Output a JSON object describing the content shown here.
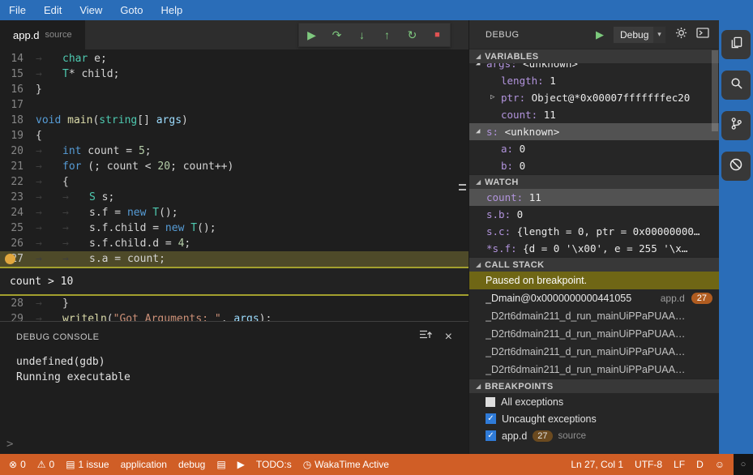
{
  "menubar": {
    "items": [
      "File",
      "Edit",
      "View",
      "Goto",
      "Help"
    ]
  },
  "tab": {
    "name": "app.d",
    "hint": "source"
  },
  "icons": {
    "section": "◢",
    "expanded": "◢",
    "collapsed": "▷",
    "play": "▶",
    "step_over": "↷",
    "step_into": "↓",
    "step_out": "↑",
    "restart": "↻",
    "stop": "■",
    "close": "×",
    "dropdown_caret": "▾",
    "check": "✓",
    "error": "⊗",
    "warning": "⚠",
    "issues": "▤",
    "note": "▤",
    "run_arrow": "▶",
    "clock": "◷",
    "smiley": "☺",
    "circle": "○",
    "prompt": ">"
  },
  "debug_toolbar": {
    "buttons": [
      {
        "name": "continue",
        "icon": "play",
        "color": "green"
      },
      {
        "name": "step-over",
        "icon": "step_over",
        "color": "green"
      },
      {
        "name": "step-into",
        "icon": "step_into",
        "color": "green"
      },
      {
        "name": "step-out",
        "icon": "step_out",
        "color": "green"
      },
      {
        "name": "restart",
        "icon": "restart",
        "color": "green"
      },
      {
        "name": "stop",
        "icon": "stop",
        "color": "red"
      }
    ]
  },
  "editor": {
    "tab_glyph": "→",
    "peek": {
      "after_line": 27,
      "text": "count > 10"
    },
    "lines": [
      {
        "n": 14,
        "tokens": [
          [
            "tab"
          ],
          [
            "type",
            "char"
          ],
          [
            "txt",
            " e;"
          ]
        ]
      },
      {
        "n": 15,
        "tokens": [
          [
            "tab"
          ],
          [
            "type",
            "T"
          ],
          [
            "txt",
            "* child;"
          ]
        ]
      },
      {
        "n": 16,
        "tokens": [
          [
            "txt",
            "}"
          ]
        ]
      },
      {
        "n": 17,
        "tokens": []
      },
      {
        "n": 18,
        "tokens": [
          [
            "kw",
            "void"
          ],
          [
            "txt",
            " "
          ],
          [
            "fn",
            "main"
          ],
          [
            "txt",
            "("
          ],
          [
            "type",
            "string"
          ],
          [
            "txt",
            "[] "
          ],
          [
            "var",
            "args"
          ],
          [
            "txt",
            ")"
          ]
        ]
      },
      {
        "n": 19,
        "tokens": [
          [
            "txt",
            "{"
          ]
        ]
      },
      {
        "n": 20,
        "tokens": [
          [
            "tab"
          ],
          [
            "kw",
            "int"
          ],
          [
            "txt",
            " count = "
          ],
          [
            "num",
            "5"
          ],
          [
            "txt",
            ";"
          ]
        ]
      },
      {
        "n": 21,
        "tokens": [
          [
            "tab"
          ],
          [
            "kw",
            "for"
          ],
          [
            "txt",
            " (; count < "
          ],
          [
            "num",
            "20"
          ],
          [
            "txt",
            "; count++)"
          ]
        ]
      },
      {
        "n": 22,
        "tokens": [
          [
            "tab"
          ],
          [
            "txt",
            "{"
          ]
        ]
      },
      {
        "n": 23,
        "tokens": [
          [
            "tab"
          ],
          [
            "tab"
          ],
          [
            "type",
            "S"
          ],
          [
            "txt",
            " s;"
          ]
        ]
      },
      {
        "n": 24,
        "tokens": [
          [
            "tab"
          ],
          [
            "tab"
          ],
          [
            "txt",
            "s.f = "
          ],
          [
            "kw",
            "new"
          ],
          [
            "txt",
            " "
          ],
          [
            "type",
            "T"
          ],
          [
            "txt",
            "();"
          ]
        ]
      },
      {
        "n": 25,
        "tokens": [
          [
            "tab"
          ],
          [
            "tab"
          ],
          [
            "txt",
            "s.f.child = "
          ],
          [
            "kw",
            "new"
          ],
          [
            "txt",
            " "
          ],
          [
            "type",
            "T"
          ],
          [
            "txt",
            "();"
          ]
        ]
      },
      {
        "n": 26,
        "tokens": [
          [
            "tab"
          ],
          [
            "tab"
          ],
          [
            "txt",
            "s.f.child.d = "
          ],
          [
            "num",
            "4"
          ],
          [
            "txt",
            ";"
          ]
        ]
      },
      {
        "n": 27,
        "current": true,
        "breakpoint": true,
        "tokens": [
          [
            "tab"
          ],
          [
            "tab"
          ],
          [
            "txt",
            "s.a = count;"
          ]
        ]
      },
      {
        "n": 28,
        "tokens": [
          [
            "tab"
          ],
          [
            "txt",
            "}"
          ]
        ]
      },
      {
        "n": 29,
        "tokens": [
          [
            "tab"
          ],
          [
            "fn",
            "writeln"
          ],
          [
            "txt",
            "("
          ],
          [
            "str",
            "\"Got Arguments: \""
          ],
          [
            "txt",
            ", "
          ],
          [
            "var",
            "args"
          ],
          [
            "txt",
            ");"
          ]
        ]
      }
    ]
  },
  "console": {
    "title": "DEBUG CONSOLE",
    "lines": [
      "undefined(gdb)",
      "Running executable"
    ],
    "prompt": ">"
  },
  "debug_panel": {
    "title": "DEBUG",
    "dropdown": "Debug"
  },
  "variables": {
    "title": "VARIABLES",
    "rows": [
      {
        "indent": 1,
        "arrow": "expanded",
        "name": "args",
        "value": "<unknown>"
      },
      {
        "indent": 2,
        "name": "length",
        "value": "1"
      },
      {
        "indent": 2,
        "arrow": "collapsed",
        "name": "ptr",
        "value": "Object@*0x00007fffffffec20"
      },
      {
        "indent": 2,
        "name": "count",
        "value": "11"
      },
      {
        "indent": 1,
        "arrow": "expanded",
        "name": "s",
        "value": "<unknown>",
        "selected": true
      },
      {
        "indent": 2,
        "name": "a",
        "value": "0"
      },
      {
        "indent": 2,
        "name": "b",
        "value": "0"
      }
    ]
  },
  "watch": {
    "title": "WATCH",
    "rows": [
      {
        "indent": 1,
        "name": "count",
        "value": "11",
        "selected": true
      },
      {
        "indent": 1,
        "name": "s.b",
        "value": "0"
      },
      {
        "indent": 1,
        "name": "s.c",
        "value": "{length = 0, ptr = 0x00000000…"
      },
      {
        "indent": 1,
        "name": "*s.f",
        "value": "{d = 0 '\\x00', e = 255 '\\x…"
      }
    ]
  },
  "call_stack": {
    "title": "CALL STACK",
    "message": "Paused on breakpoint.",
    "frames": [
      {
        "name": "_Dmain@0x0000000000441055",
        "file": "app.d",
        "line": "27"
      },
      {
        "name": "_D2rt6dmain211_d_run_mainUiPPaPUAA…"
      },
      {
        "name": "_D2rt6dmain211_d_run_mainUiPPaPUAA…"
      },
      {
        "name": "_D2rt6dmain211_d_run_mainUiPPaPUAA…"
      },
      {
        "name": "_D2rt6dmain211_d_run_mainUiPPaPUAA…"
      }
    ]
  },
  "breakpoints": {
    "title": "BREAKPOINTS",
    "rows": [
      {
        "checked": false,
        "label": "All exceptions"
      },
      {
        "checked": true,
        "label": "Uncaught exceptions"
      },
      {
        "checked": true,
        "label": "app.d",
        "badge": "27",
        "hint": "source"
      }
    ]
  },
  "statusbar": {
    "left": [
      {
        "name": "errors",
        "icon": "error",
        "text": "0"
      },
      {
        "name": "warnings",
        "icon": "warning",
        "text": "0"
      },
      {
        "name": "issues",
        "icon": "issues",
        "text": "1 issue"
      },
      {
        "name": "application",
        "text": "application"
      },
      {
        "name": "debug",
        "text": "debug"
      },
      {
        "name": "note",
        "icon": "note"
      },
      {
        "name": "run",
        "icon": "run_arrow"
      },
      {
        "name": "todos",
        "text": "TODO:s"
      },
      {
        "name": "wakatime",
        "icon": "clock",
        "text": "WakaTime Active"
      }
    ],
    "right": [
      {
        "name": "cursor-position",
        "text": "Ln 27, Col 1"
      },
      {
        "name": "encoding",
        "text": "UTF-8"
      },
      {
        "name": "eol",
        "text": "LF"
      },
      {
        "name": "language",
        "text": "D"
      },
      {
        "name": "feedback",
        "icon": "smiley"
      }
    ]
  }
}
